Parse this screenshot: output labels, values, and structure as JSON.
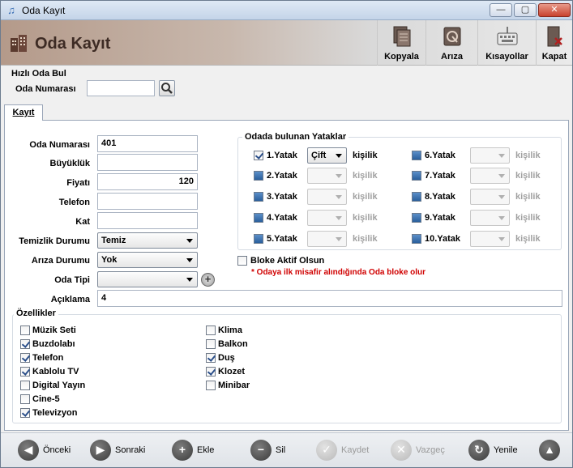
{
  "window": {
    "title": "Oda Kayıt",
    "minimize": "—",
    "maximize": "▢",
    "close": "✕"
  },
  "header": {
    "title": "Oda Kayıt",
    "buttons": {
      "kopyala": "Kopyala",
      "ariza": "Arıza",
      "kisayollar": "Kısayollar",
      "kapat": "Kapat"
    }
  },
  "quick_find": {
    "title": "Hızlı Oda Bul",
    "label": "Oda Numarası",
    "value": ""
  },
  "tab": {
    "label": "Kayıt"
  },
  "form": {
    "oda_numarasi": {
      "label": "Oda Numarası",
      "value": "401"
    },
    "buyukluk": {
      "label": "Büyüklük",
      "value": ""
    },
    "fiyati": {
      "label": "Fiyatı",
      "value": "120"
    },
    "telefon": {
      "label": "Telefon",
      "value": ""
    },
    "kat": {
      "label": "Kat",
      "value": ""
    },
    "temizlik_durumu": {
      "label": "Temizlik Durumu",
      "value": "Temiz"
    },
    "ariza_durumu": {
      "label": "Arıza Durumu",
      "value": "Yok"
    },
    "oda_tipi": {
      "label": "Oda Tipi",
      "value": ""
    },
    "aciklama": {
      "label": "Açıklama",
      "value": "4"
    }
  },
  "beds": {
    "title": "Odada bulunan Yataklar",
    "unit": "kişilik",
    "items": [
      {
        "label": "1.Yatak",
        "value": "Çift",
        "checked": true
      },
      {
        "label": "2.Yatak",
        "value": "",
        "checked": false
      },
      {
        "label": "3.Yatak",
        "value": "",
        "checked": false
      },
      {
        "label": "4.Yatak",
        "value": "",
        "checked": false
      },
      {
        "label": "5.Yatak",
        "value": "",
        "checked": false
      },
      {
        "label": "6.Yatak",
        "value": "",
        "checked": false
      },
      {
        "label": "7.Yatak",
        "value": "",
        "checked": false
      },
      {
        "label": "8.Yatak",
        "value": "",
        "checked": false
      },
      {
        "label": "9.Yatak",
        "value": "",
        "checked": false
      },
      {
        "label": "10.Yatak",
        "value": "",
        "checked": false
      }
    ]
  },
  "block": {
    "label": "Bloke Aktif Olsun",
    "note": "* Odaya ilk misafir alındığında Oda bloke olur",
    "checked": false
  },
  "features": {
    "title": "Özellikler",
    "left": [
      {
        "label": "Müzik Seti",
        "checked": false
      },
      {
        "label": "Buzdolabı",
        "checked": true
      },
      {
        "label": "Telefon",
        "checked": true
      },
      {
        "label": "Kablolu TV",
        "checked": true
      },
      {
        "label": "Digital Yayın",
        "checked": false
      },
      {
        "label": "Cine-5",
        "checked": false
      },
      {
        "label": "Televizyon",
        "checked": true
      }
    ],
    "right": [
      {
        "label": "Klima",
        "checked": false
      },
      {
        "label": "Balkon",
        "checked": false
      },
      {
        "label": "Duş",
        "checked": true
      },
      {
        "label": "Klozet",
        "checked": true
      },
      {
        "label": "Minibar",
        "checked": false
      }
    ]
  },
  "bottom": {
    "onceki": "Önceki",
    "sonraki": "Sonraki",
    "ekle": "Ekle",
    "sil": "Sil",
    "kaydet": "Kaydet",
    "vazgec": "Vazgeç",
    "yenile": "Yenile"
  }
}
